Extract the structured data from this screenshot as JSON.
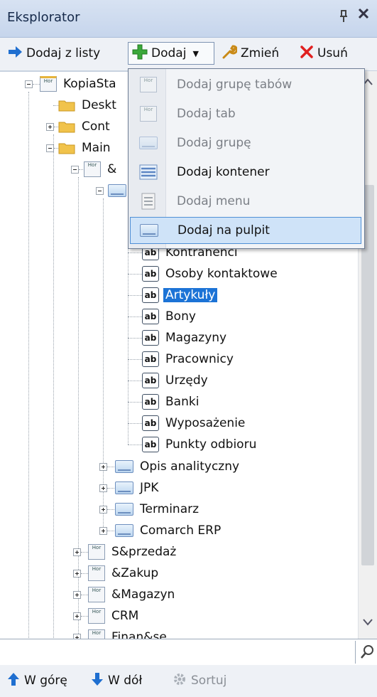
{
  "window": {
    "title": "Eksplorator",
    "pin": "ᴪ",
    "close": "✕"
  },
  "toolbar": {
    "add_from_list": "Dodaj z listy",
    "add": "Dodaj",
    "change": "Zmień",
    "delete": "Usuń"
  },
  "tree": {
    "root": "KopiaSta",
    "desk": "Deskt",
    "cont": "Cont",
    "main": "Main",
    "amp": "&",
    "items": [
      "Kontrahenci",
      "Osoby kontaktowe",
      "Artykuły",
      "Bony",
      "Magazyny",
      "Pracownicy",
      "Urzędy",
      "Banki",
      "Wyposażenie",
      "Punkty odbioru"
    ],
    "groups": [
      "Opis analityczny",
      "JPK",
      "Terminarz",
      "Comarch ERP"
    ],
    "tabs": [
      "S&przedaż",
      "&Zakup",
      "&Magazyn",
      "CRM",
      "Finan&se"
    ],
    "ab_text": "ab",
    "tab_icon_text": "Hor"
  },
  "menu": {
    "items": [
      {
        "label": "Dodaj grupę tabów",
        "enabled": false
      },
      {
        "label": "Dodaj tab",
        "enabled": false
      },
      {
        "label": "Dodaj grupę",
        "enabled": false
      },
      {
        "label": "Dodaj kontener",
        "enabled": true
      },
      {
        "label": "Dodaj menu",
        "enabled": false
      },
      {
        "label": "Dodaj na pulpit",
        "enabled": true,
        "highlighted": true
      }
    ]
  },
  "search": {
    "value": "",
    "placeholder": ""
  },
  "bottom": {
    "up": "W górę",
    "down": "W dół",
    "sort": "Sortuj"
  },
  "colors": {
    "selection": "#1c73d6",
    "menu_highlight": "#cfe3f8",
    "add_icon": "#3aa83a",
    "delete_icon": "#e02020",
    "arrow_icon": "#1f6fd0"
  }
}
